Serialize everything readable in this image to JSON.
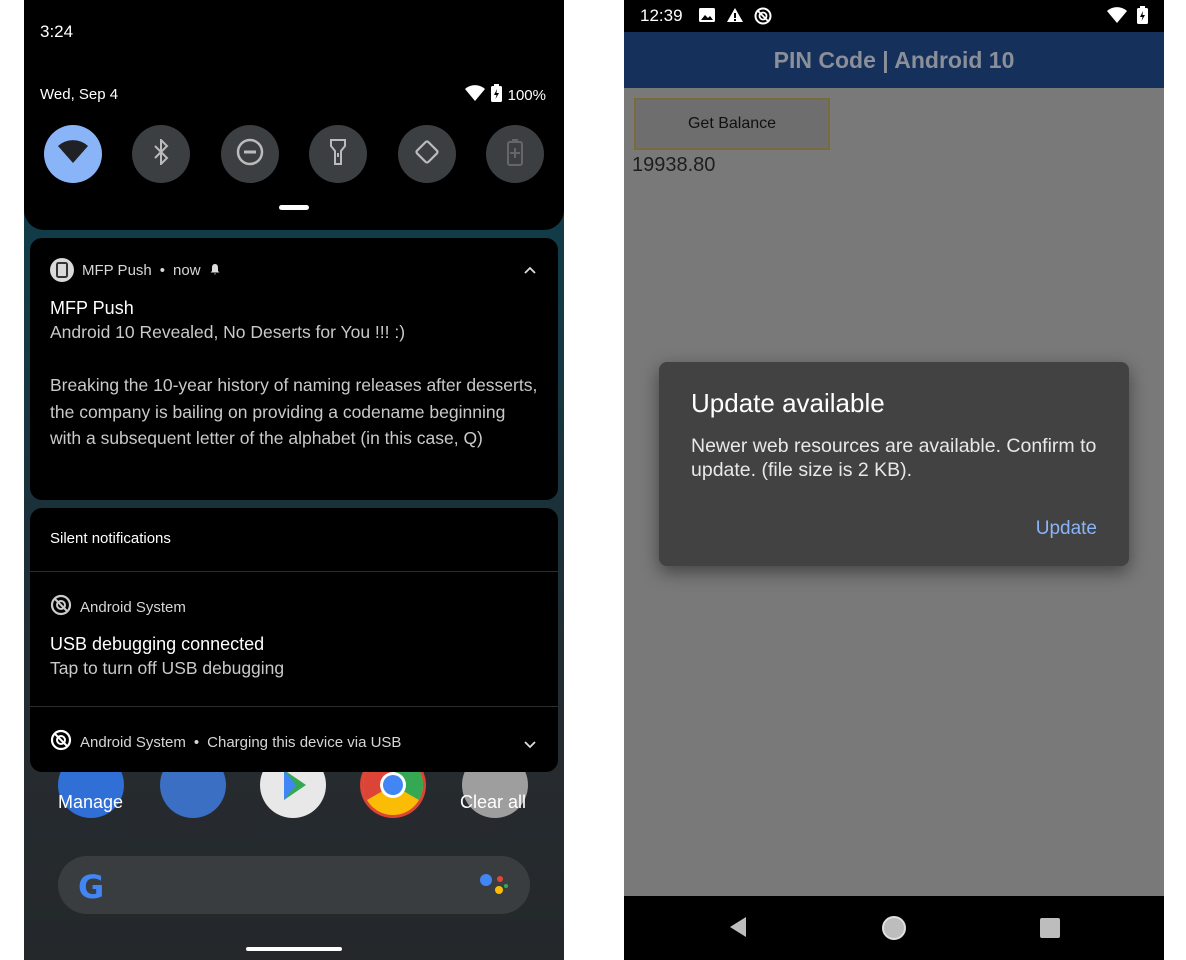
{
  "left": {
    "time": "3:24",
    "date": "Wed, Sep 4",
    "battery": "100%",
    "tiles": [
      {
        "name": "wifi",
        "on": true
      },
      {
        "name": "bluetooth",
        "on": false
      },
      {
        "name": "do-not-disturb",
        "on": false
      },
      {
        "name": "flashlight",
        "on": false
      },
      {
        "name": "auto-rotate",
        "on": false
      },
      {
        "name": "battery-saver",
        "on": false
      }
    ],
    "notif1": {
      "app": "MFP Push",
      "time": "now",
      "title": "MFP Push",
      "subtitle": "Android 10 Revealed, No Deserts for You !!! :)",
      "body": "Breaking the 10-year history of naming releases after desserts, the company is bailing on providing a codename beginning with a subsequent letter of the alphabet (in this case, Q)"
    },
    "silent_header": "Silent notifications",
    "notif2": {
      "app": "Android System",
      "title": "USB debugging connected",
      "body": "Tap to turn off USB debugging"
    },
    "notif3": {
      "app": "Android System",
      "detail": "Charging this device via USB"
    },
    "manage": "Manage",
    "clear_all": "Clear all",
    "search_logo": "G"
  },
  "right": {
    "time": "12:39",
    "header": "PIN Code | Android 10",
    "button": "Get Balance",
    "balance": "19938.80",
    "dialog": {
      "title": "Update available",
      "message": "Newer web resources are available. Confirm to update. (file size is 2 KB).",
      "action": "Update"
    }
  },
  "colors": {
    "accent_blue": "#8ab4f8",
    "app_bar": "#15305a",
    "scrim_bg": "#797979"
  }
}
